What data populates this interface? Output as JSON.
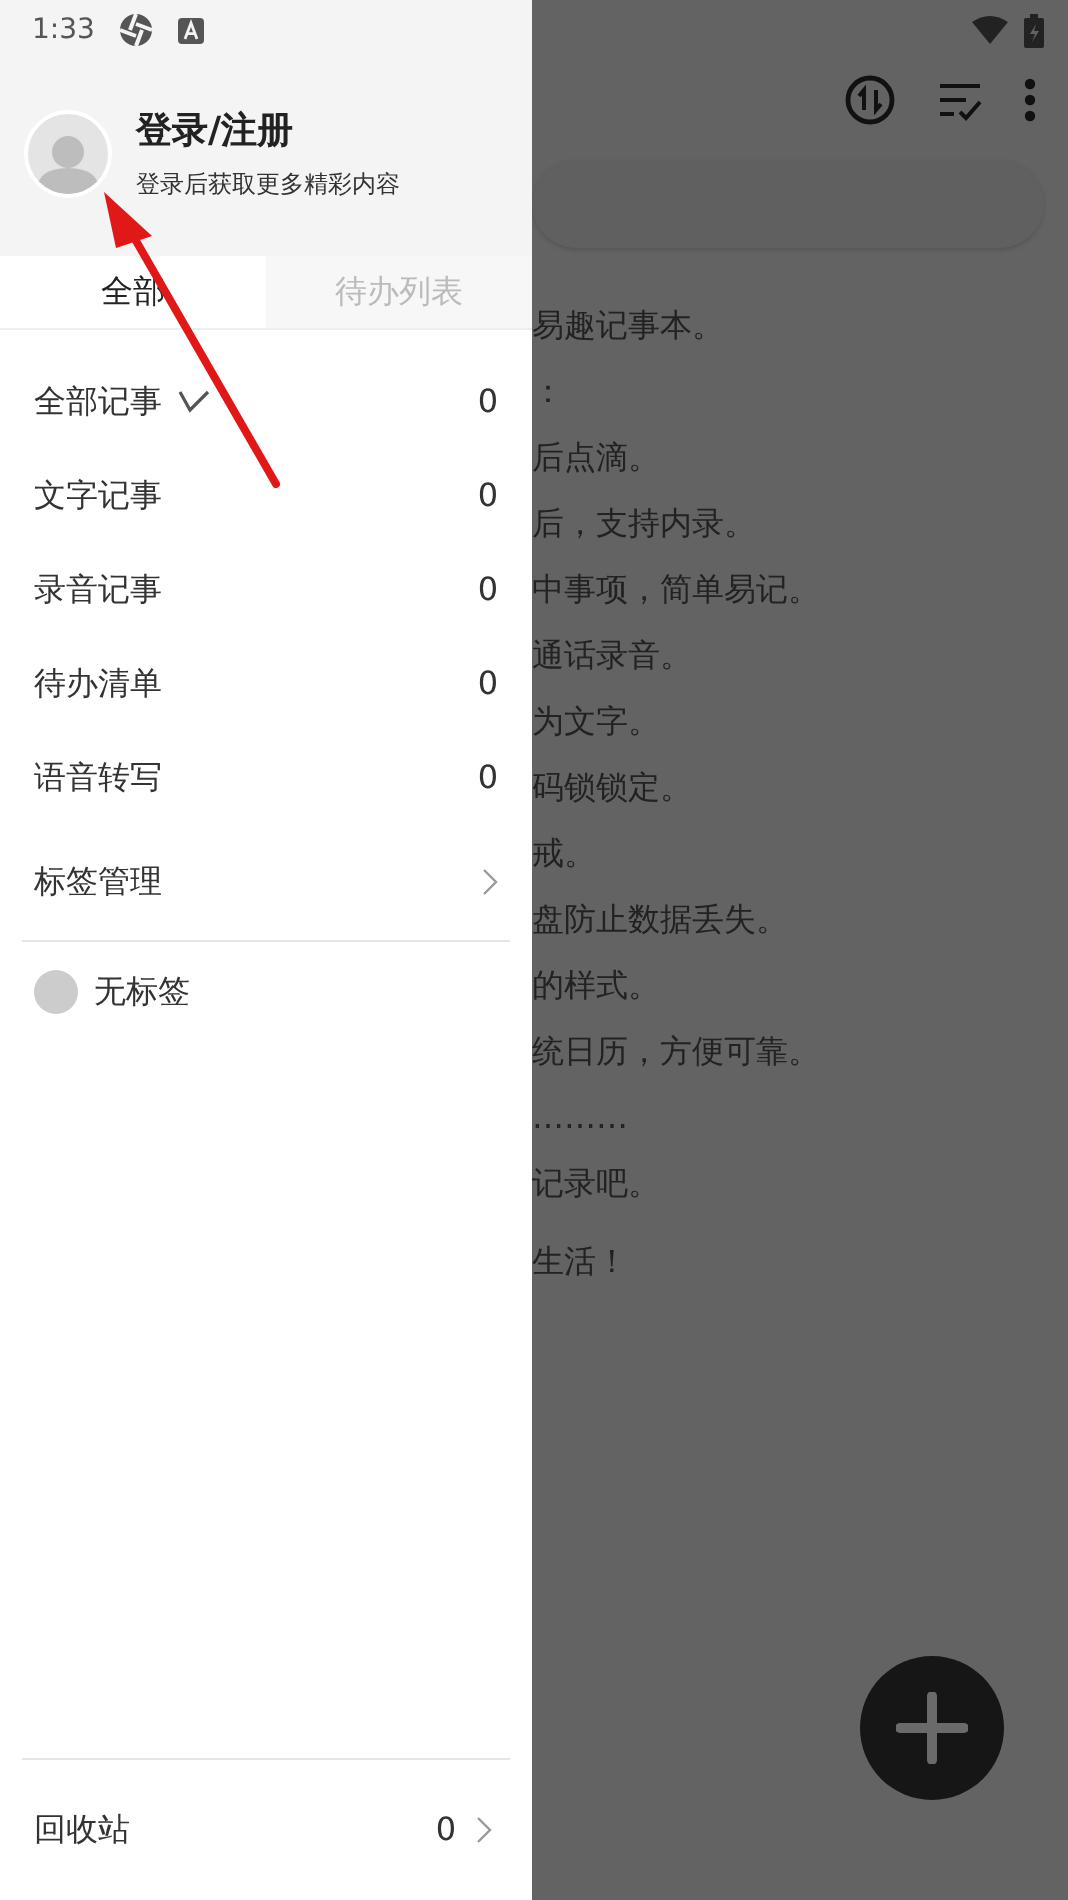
{
  "status_bar": {
    "time": "1:33"
  },
  "drawer": {
    "header": {
      "title": "登录/注册",
      "subtitle": "登录后获取更多精彩内容"
    },
    "tabs": [
      {
        "label": "全部",
        "selected": true
      },
      {
        "label": "待办列表",
        "selected": false
      }
    ],
    "items": [
      {
        "kind": "count",
        "label": "全部记事",
        "count": "0",
        "selected": true
      },
      {
        "kind": "count",
        "label": "文字记事",
        "count": "0",
        "selected": false
      },
      {
        "kind": "count",
        "label": "录音记事",
        "count": "0",
        "selected": false
      },
      {
        "kind": "count",
        "label": "待办清单",
        "count": "0",
        "selected": false
      },
      {
        "kind": "count",
        "label": "语音转写",
        "count": "0",
        "selected": false
      },
      {
        "kind": "link",
        "label": "标签管理"
      }
    ],
    "tags": [
      {
        "label": "无标签",
        "color": "#cccccc"
      }
    ],
    "footer": {
      "label": "回收站",
      "count": "0"
    }
  },
  "background_note": {
    "lines": [
      "易趣记事本。",
      "：",
      "后点滴。",
      "后，支持内录。",
      "中事项，简单易记。",
      "通话录音。",
      "为文字。",
      "码锁锁定。",
      "戒。",
      "盘防止数据丢失。",
      "的样式。",
      "统日历，方便可靠。",
      "………",
      "记录吧。",
      "生活！"
    ]
  },
  "annotation": {
    "kind": "arrow"
  }
}
